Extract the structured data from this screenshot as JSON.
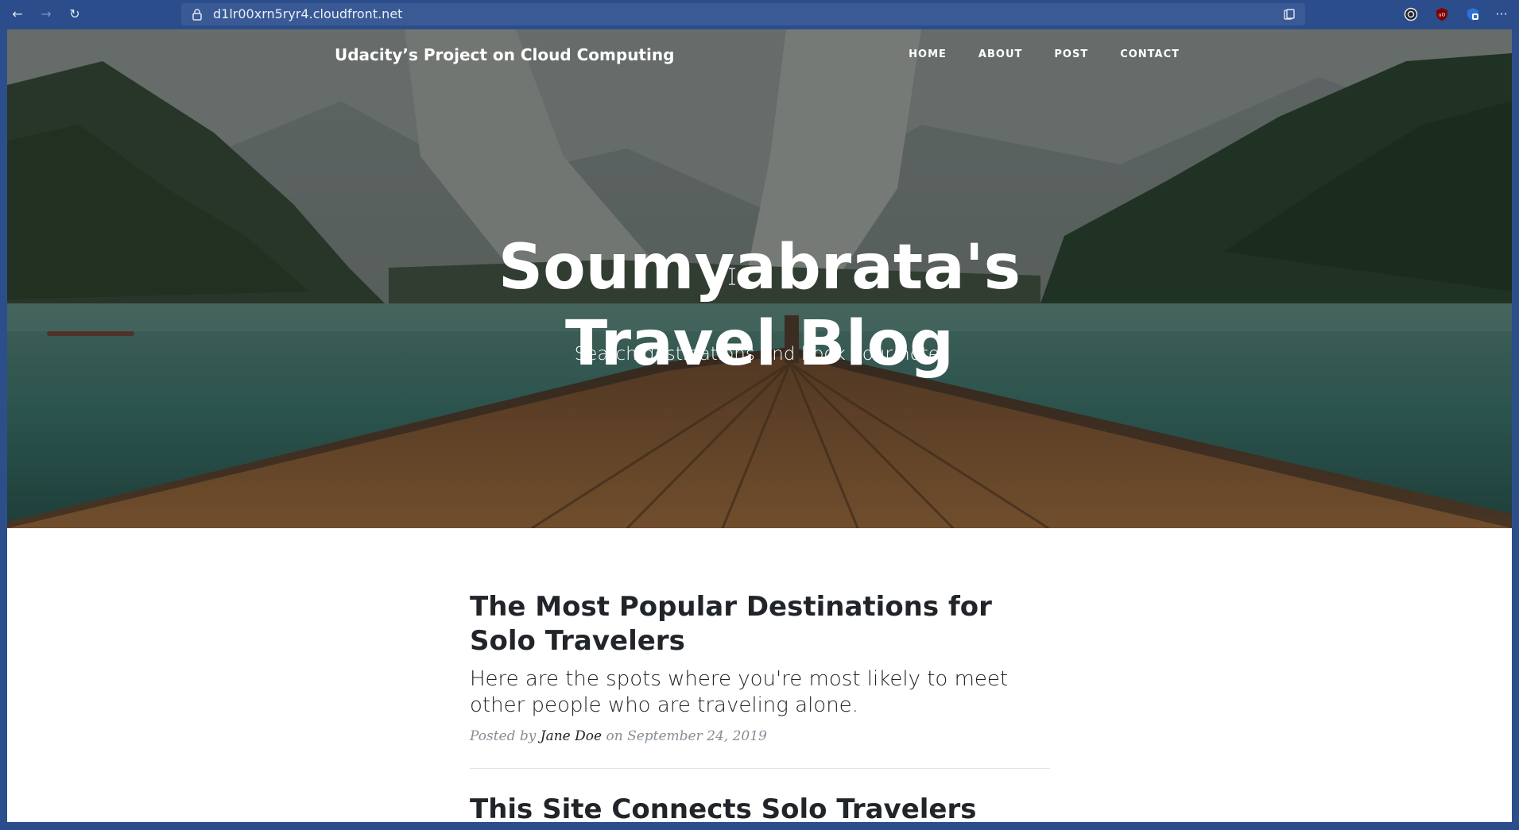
{
  "browser": {
    "url": "d1lr00xrn5ryr4.cloudfront.net",
    "back_icon": "←",
    "forward_icon": "→",
    "reload_icon": "↻",
    "menu_icon": "···"
  },
  "site": {
    "brand": "Udacity’s Project on Cloud Computing",
    "nav": [
      "HOME",
      "ABOUT",
      "POST",
      "CONTACT"
    ]
  },
  "hero": {
    "title_line1": "Soumyabrata's",
    "title_line2": "Travel Blog",
    "subtitle": "Search destinations and book your hotel"
  },
  "posts": [
    {
      "title": "The Most Popular Destinations for Solo Travelers",
      "subtitle": "Here are the spots where you're most likely to meet other people who are traveling alone.",
      "meta_prefix": "Posted by",
      "author": "Jane Doe",
      "meta_date": "on September 24, 2019"
    },
    {
      "title": "This Site Connects Solo Travelers Who"
    }
  ],
  "colors": {
    "browser_chrome": "#2b4d8b",
    "url_bar": "#3a5a96",
    "heading_text": "#212529",
    "meta_text": "#868e96"
  }
}
